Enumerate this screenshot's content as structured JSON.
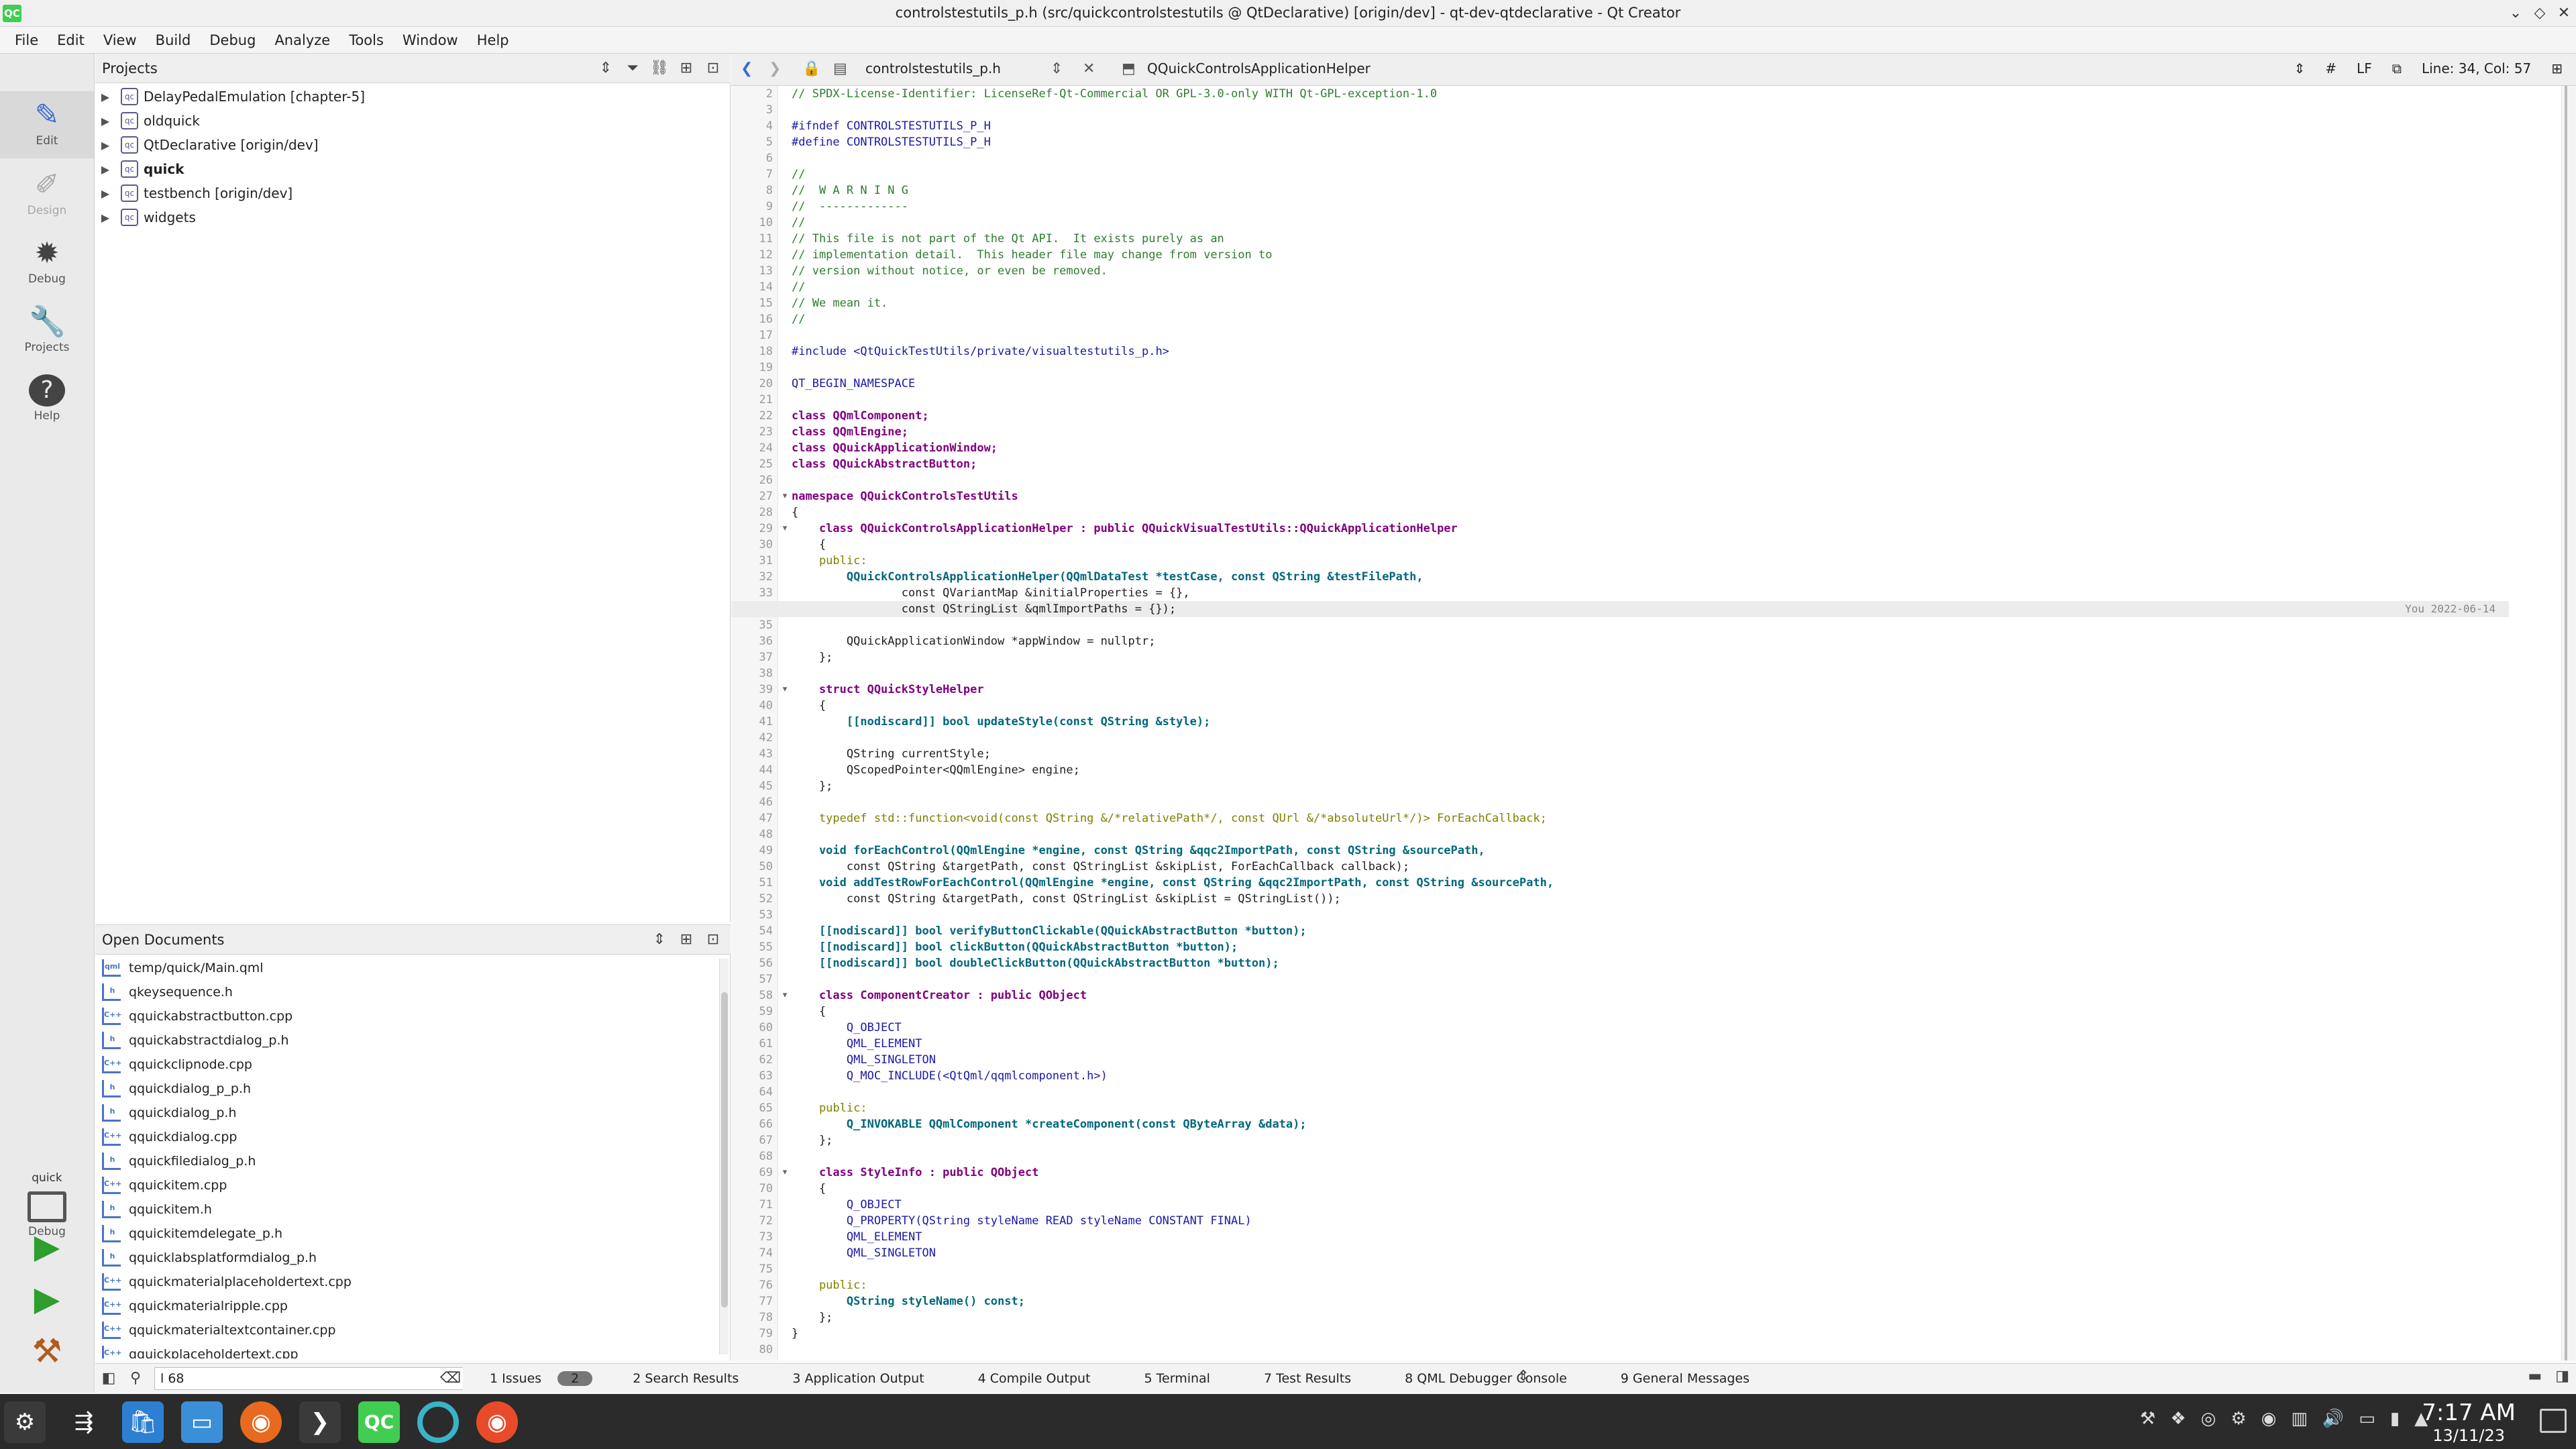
{
  "window": {
    "title": "controlstestutils_p.h (src/quickcontrolstestutils @ QtDeclarative) [origin/dev] - qt-dev-qtdeclarative - Qt Creator",
    "logo": "QC",
    "buttons": [
      "⌄",
      "◇",
      "✕"
    ]
  },
  "menu": [
    "File",
    "Edit",
    "View",
    "Build",
    "Debug",
    "Analyze",
    "Tools",
    "Window",
    "Help"
  ],
  "modes": [
    {
      "label": "Edit",
      "icon": "✎"
    },
    {
      "label": "Design",
      "icon": "✐"
    },
    {
      "label": "Debug",
      "icon": "✹"
    },
    {
      "label": "Projects",
      "icon": "🔧"
    },
    {
      "label": "Help",
      "icon": "?"
    }
  ],
  "kit": {
    "name": "quick",
    "label": "Debug"
  },
  "projects": {
    "title": "Projects",
    "items": [
      {
        "name": "DelayPedalEmulation [chapter-5]",
        "bold": false
      },
      {
        "name": "oldquick",
        "bold": false
      },
      {
        "name": "QtDeclarative [origin/dev]",
        "bold": false
      },
      {
        "name": "quick",
        "bold": true
      },
      {
        "name": "testbench [origin/dev]",
        "bold": false
      },
      {
        "name": "widgets",
        "bold": false
      }
    ]
  },
  "open_documents": {
    "title": "Open Documents",
    "files": [
      {
        "name": "temp/quick/Main.qml",
        "type": "qml"
      },
      {
        "name": "qkeysequence.h",
        "type": "h"
      },
      {
        "name": "qquickabstractbutton.cpp",
        "type": "C++"
      },
      {
        "name": "qquickabstractdialog_p.h",
        "type": "h"
      },
      {
        "name": "qquickclipnode.cpp",
        "type": "C++"
      },
      {
        "name": "qquickdialog_p_p.h",
        "type": "h"
      },
      {
        "name": "qquickdialog_p.h",
        "type": "h"
      },
      {
        "name": "qquickdialog.cpp",
        "type": "C++"
      },
      {
        "name": "qquickfiledialog_p.h",
        "type": "h"
      },
      {
        "name": "qquickitem.cpp",
        "type": "C++"
      },
      {
        "name": "qquickitem.h",
        "type": "h"
      },
      {
        "name": "qquickitemdelegate_p.h",
        "type": "h"
      },
      {
        "name": "qquicklabsplatformdialog_p.h",
        "type": "h"
      },
      {
        "name": "qquickmaterialplaceholdertext.cpp",
        "type": "C++"
      },
      {
        "name": "qquickmaterialripple.cpp",
        "type": "C++"
      },
      {
        "name": "qquickmaterialtextcontainer.cpp",
        "type": "C++"
      },
      {
        "name": "qquickplaceholdertext.cpp",
        "type": "C++"
      }
    ]
  },
  "locator": {
    "value": "l 68"
  },
  "editor": {
    "file": "controlstestutils_p.h",
    "symbol": "QQuickControlsApplicationHelper",
    "hash": "#",
    "line_ending": "LF",
    "position": "Line: 34, Col: 57",
    "blame": "You 2022-06-14",
    "current_line": 34
  },
  "code_lines": [
    {
      "n": 2,
      "t": "// SPDX-License-Identifier: LicenseRef-Qt-Commercial OR GPL-3.0-only WITH Qt-GPL-exception-1.0",
      "c": "cm"
    },
    {
      "n": 3,
      "t": "",
      "c": ""
    },
    {
      "n": 4,
      "t": "#ifndef CONTROLSTESTUTILS_P_H",
      "c": "pp"
    },
    {
      "n": 5,
      "t": "#define CONTROLSTESTUTILS_P_H",
      "c": "pp"
    },
    {
      "n": 6,
      "t": "",
      "c": ""
    },
    {
      "n": 7,
      "t": "//",
      "c": "cm"
    },
    {
      "n": 8,
      "t": "//  W A R N I N G",
      "c": "cm"
    },
    {
      "n": 9,
      "t": "//  -------------",
      "c": "cm"
    },
    {
      "n": 10,
      "t": "//",
      "c": "cm"
    },
    {
      "n": 11,
      "t": "// This file is not part of the Qt API.  It exists purely as an",
      "c": "cm"
    },
    {
      "n": 12,
      "t": "// implementation detail.  This header file may change from version to",
      "c": "cm"
    },
    {
      "n": 13,
      "t": "// version without notice, or even be removed.",
      "c": "cm"
    },
    {
      "n": 14,
      "t": "//",
      "c": "cm"
    },
    {
      "n": 15,
      "t": "// We mean it.",
      "c": "cm"
    },
    {
      "n": 16,
      "t": "//",
      "c": "cm"
    },
    {
      "n": 17,
      "t": "",
      "c": ""
    },
    {
      "n": 18,
      "t": "#include <QtQuickTestUtils/private/visualtestutils_p.h>",
      "c": "pp"
    },
    {
      "n": 19,
      "t": "",
      "c": ""
    },
    {
      "n": 20,
      "t": "QT_BEGIN_NAMESPACE",
      "c": "pp"
    },
    {
      "n": 21,
      "t": "",
      "c": ""
    },
    {
      "n": 22,
      "t": "class QQmlComponent;",
      "c": "ty"
    },
    {
      "n": 23,
      "t": "class QQmlEngine;",
      "c": "ty"
    },
    {
      "n": 24,
      "t": "class QQuickApplicationWindow;",
      "c": "ty"
    },
    {
      "n": 25,
      "t": "class QQuickAbstractButton;",
      "c": "ty"
    },
    {
      "n": 26,
      "t": "",
      "c": ""
    },
    {
      "n": 27,
      "t": "namespace QQuickControlsTestUtils",
      "c": "ty",
      "fold": true
    },
    {
      "n": 28,
      "t": "{",
      "c": ""
    },
    {
      "n": 29,
      "t": "    class QQuickControlsApplicationHelper : public QQuickVisualTestUtils::QQuickApplicationHelper",
      "c": "ty",
      "fold": true
    },
    {
      "n": 30,
      "t": "    {",
      "c": ""
    },
    {
      "n": 31,
      "t": "    public:",
      "c": "kw"
    },
    {
      "n": 32,
      "t": "        QQuickControlsApplicationHelper(QQmlDataTest *testCase, const QString &testFilePath,",
      "c": "fn"
    },
    {
      "n": 33,
      "t": "                const QVariantMap &initialProperties = {},",
      "c": ""
    },
    {
      "n": 34,
      "t": "                const QStringList &qmlImportPaths = {});",
      "c": ""
    },
    {
      "n": 35,
      "t": "",
      "c": ""
    },
    {
      "n": 36,
      "t": "        QQuickApplicationWindow *appWindow = nullptr;",
      "c": ""
    },
    {
      "n": 37,
      "t": "    };",
      "c": ""
    },
    {
      "n": 38,
      "t": "",
      "c": ""
    },
    {
      "n": 39,
      "t": "    struct QQuickStyleHelper",
      "c": "ty",
      "fold": true
    },
    {
      "n": 40,
      "t": "    {",
      "c": ""
    },
    {
      "n": 41,
      "t": "        [[nodiscard]] bool updateStyle(const QString &style);",
      "c": "fn"
    },
    {
      "n": 42,
      "t": "",
      "c": ""
    },
    {
      "n": 43,
      "t": "        QString currentStyle;",
      "c": ""
    },
    {
      "n": 44,
      "t": "        QScopedPointer<QQmlEngine> engine;",
      "c": ""
    },
    {
      "n": 45,
      "t": "    };",
      "c": ""
    },
    {
      "n": 46,
      "t": "",
      "c": ""
    },
    {
      "n": 47,
      "t": "    typedef std::function<void(const QString &/*relativePath*/, const QUrl &/*absoluteUrl*/)> ForEachCallback;",
      "c": "kw"
    },
    {
      "n": 48,
      "t": "",
      "c": ""
    },
    {
      "n": 49,
      "t": "    void forEachControl(QQmlEngine *engine, const QString &qqc2ImportPath, const QString &sourcePath,",
      "c": "fn"
    },
    {
      "n": 50,
      "t": "        const QString &targetPath, const QStringList &skipList, ForEachCallback callback);",
      "c": ""
    },
    {
      "n": 51,
      "t": "    void addTestRowForEachControl(QQmlEngine *engine, const QString &qqc2ImportPath, const QString &sourcePath,",
      "c": "fn"
    },
    {
      "n": 52,
      "t": "        const QString &targetPath, const QStringList &skipList = QStringList());",
      "c": ""
    },
    {
      "n": 53,
      "t": "",
      "c": ""
    },
    {
      "n": 54,
      "t": "    [[nodiscard]] bool verifyButtonClickable(QQuickAbstractButton *button);",
      "c": "fn"
    },
    {
      "n": 55,
      "t": "    [[nodiscard]] bool clickButton(QQuickAbstractButton *button);",
      "c": "fn"
    },
    {
      "n": 56,
      "t": "    [[nodiscard]] bool doubleClickButton(QQuickAbstractButton *button);",
      "c": "fn"
    },
    {
      "n": 57,
      "t": "",
      "c": ""
    },
    {
      "n": 58,
      "t": "    class ComponentCreator : public QObject",
      "c": "ty",
      "fold": true
    },
    {
      "n": 59,
      "t": "    {",
      "c": ""
    },
    {
      "n": 60,
      "t": "        Q_OBJECT",
      "c": "pp"
    },
    {
      "n": 61,
      "t": "        QML_ELEMENT",
      "c": "pp"
    },
    {
      "n": 62,
      "t": "        QML_SINGLETON",
      "c": "pp"
    },
    {
      "n": 63,
      "t": "        Q_MOC_INCLUDE(<QtQml/qqmlcomponent.h>)",
      "c": "pp"
    },
    {
      "n": 64,
      "t": "",
      "c": ""
    },
    {
      "n": 65,
      "t": "    public:",
      "c": "kw"
    },
    {
      "n": 66,
      "t": "        Q_INVOKABLE QQmlComponent *createComponent(const QByteArray &data);",
      "c": "fn"
    },
    {
      "n": 67,
      "t": "    };",
      "c": ""
    },
    {
      "n": 68,
      "t": "",
      "c": ""
    },
    {
      "n": 69,
      "t": "    class StyleInfo : public QObject",
      "c": "ty",
      "fold": true
    },
    {
      "n": 70,
      "t": "    {",
      "c": ""
    },
    {
      "n": 71,
      "t": "        Q_OBJECT",
      "c": "pp"
    },
    {
      "n": 72,
      "t": "        Q_PROPERTY(QString styleName READ styleName CONSTANT FINAL)",
      "c": "pp"
    },
    {
      "n": 73,
      "t": "        QML_ELEMENT",
      "c": "pp"
    },
    {
      "n": 74,
      "t": "        QML_SINGLETON",
      "c": "pp"
    },
    {
      "n": 75,
      "t": "",
      "c": ""
    },
    {
      "n": 76,
      "t": "    public:",
      "c": "kw"
    },
    {
      "n": 77,
      "t": "        QString styleName() const;",
      "c": "fn"
    },
    {
      "n": 78,
      "t": "    };",
      "c": ""
    },
    {
      "n": 79,
      "t": "}",
      "c": ""
    },
    {
      "n": 80,
      "t": "",
      "c": ""
    }
  ],
  "output_tabs": [
    {
      "label": "1  Issues",
      "badge": "2"
    },
    {
      "label": "2  Search Results"
    },
    {
      "label": "3  Application Output"
    },
    {
      "label": "4  Compile Output"
    },
    {
      "label": "5  Terminal"
    },
    {
      "label": "7  Test Results"
    },
    {
      "label": "8  QML Debugger Console"
    },
    {
      "label": "9  General Messages"
    }
  ],
  "taskbar": {
    "time": "7:17 AM",
    "date": "13/11/23",
    "apps": [
      "plasma-launcher-icon",
      "pager-icon",
      "store-icon",
      "files-icon",
      "firefox-icon",
      "terminal-icon",
      "qtcreator-icon",
      "ring-icon",
      "firefox-dev-icon"
    ]
  }
}
